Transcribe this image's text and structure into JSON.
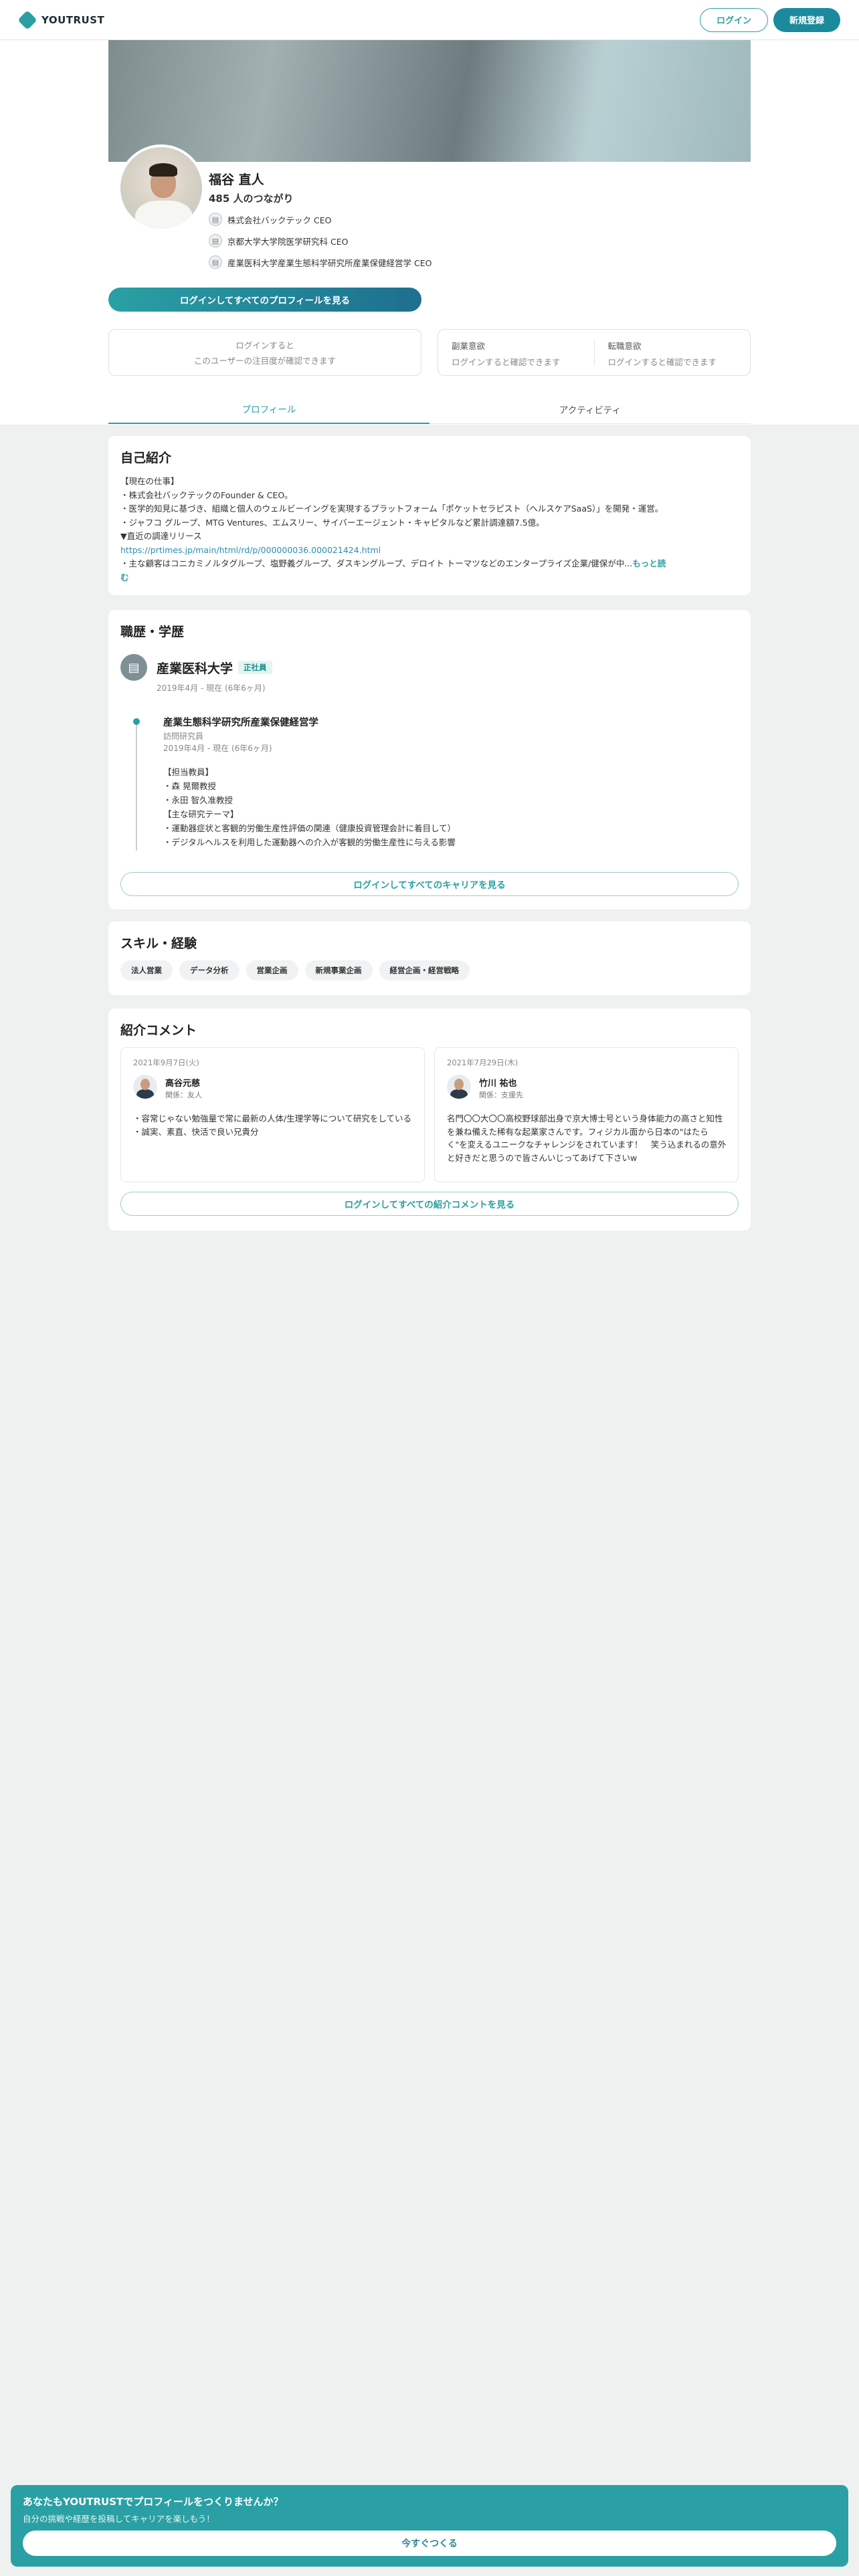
{
  "header": {
    "logo_text": "YOUTRUST",
    "login_label": "ログイン",
    "signup_label": "新規登録"
  },
  "profile": {
    "name": "福谷 直人",
    "connections": "485 人のつながり",
    "affiliations": [
      "株式会社バックテック CEO",
      "京都大学大学院医学研究科 CEO",
      "産業医科大学産業生態科学研究所産業保健経営学 CEO"
    ],
    "all_profile_button": "ログインしてすべてのプロフィールを見る",
    "attention_locked": [
      "ログインすると",
      "このユーザーの注目度が確認できます"
    ],
    "side_job": {
      "title": "副業意欲",
      "value": "ログインすると確認できます"
    },
    "job_change": {
      "title": "転職意欲",
      "value": "ログインすると確認できます"
    }
  },
  "tabs": [
    "プロフィール",
    "アクティビティ"
  ],
  "intro": {
    "title": "自己紹介",
    "lines": [
      "【現在の仕事】",
      "・株式会社バックテックのFounder & CEO。",
      "・医学的知見に基づき、組織と個人のウェルビーイングを実現するプラットフォーム「ポケットセラピスト（ヘルスケアSaaS）」を開発・運営。",
      "・ジャフコ グループ、MTG Ventures、エムスリー、サイバーエージェント・キャピタルなど累計調達額7.5億。",
      "▼直近の調達リリース"
    ],
    "link": "https://prtimes.jp/main/html/rd/p/000000036.000021424.html",
    "last_line": "・主な顧客はコニカミノルタグループ、塩野義グループ、ダスキングループ、デロイト トーマツなどのエンタープライズ企業/健保が中...",
    "more_a": "もっと読",
    "more_b": "む"
  },
  "career": {
    "title": "職歴・学歴",
    "org": "産業医科大学",
    "badge": "正社員",
    "org_period": "2019年4月 - 現在 (6年6ヶ月)",
    "position_title": "産業生態科学研究所産業保健経営学",
    "position_role": "訪問研究員",
    "position_period": "2019年4月 - 現在 (6年6ヶ月)",
    "description": [
      "【担当教員】",
      "・森 晃爾教授",
      "・永田 智久准教授",
      "【主な研究テーマ】",
      "・運動器症状と客観的労働生産性評価の関連（健康投資管理会計に着目して）",
      "・デジタルヘルスを利用した運動器への介入が客観的労働生産性に与える影響"
    ],
    "all_career_button": "ログインしてすべてのキャリアを見る"
  },
  "skills": {
    "title": "スキル・経験",
    "items": [
      "法人営業",
      "データ分析",
      "営業企画",
      "新規事業企画",
      "経営企画・経営戦略"
    ]
  },
  "recommendations": {
    "title": "紹介コメント",
    "items": [
      {
        "date": "2021年9月7日(火)",
        "name": "高谷元慈",
        "relation": "関係：友人",
        "text": [
          "・容常じゃない勉強量で常に最新の人体/生理学等について研究をしている",
          "・誠実、素直、快活で良い兄貴分"
        ]
      },
      {
        "date": "2021年7月29日(木)",
        "name": "竹川 祐也",
        "relation": "関係：支援先",
        "text": [
          "名門〇〇大〇〇高校野球部出身で京大博士号という身体能力の高さと知性を兼ね備えた稀有な起業家さんです。フィジカル面から日本の\"はたらく\"を変えるユニークなチャレンジをされています！　笑う込まれるの意外と好きだと思うので皆さんいじってあげて下さいw"
        ]
      }
    ],
    "all_button": "ログインしてすべての紹介コメントを見る"
  },
  "cta": {
    "title": "あなたもYOUTRUSTでプロフィールをつくりませんか？",
    "subtitle": "自分の挑戦や経歴を投稿してキャリアを楽しもう！",
    "button": "今すぐつくる"
  }
}
